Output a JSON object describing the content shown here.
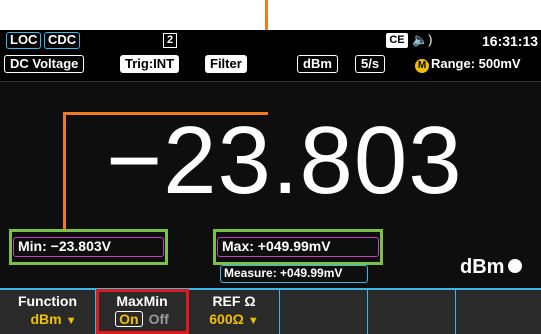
{
  "status_bar": {
    "remote_label": "LOC",
    "interface_label": "CDC",
    "page_indicator": "2",
    "ce_icon": "CE",
    "speaker_icon": "speaker-icon",
    "time": "16:31:13"
  },
  "mode_bar": {
    "function": "DC Voltage",
    "trigger": "Trig:INT",
    "filter": "Filter",
    "unit_mode": "dBm",
    "rate": "5/s",
    "manual_badge": "M",
    "range": "Range: 500mV"
  },
  "measurement": {
    "main_value": "−23.803",
    "min_label": "Min: −23.803V",
    "max_label": "Max: +049.99mV",
    "measure_label": "Measure: +049.99mV",
    "unit": "dBm"
  },
  "softkeys": [
    {
      "title": "Function",
      "value": "dBm"
    },
    {
      "title": "MaxMin",
      "on": "On",
      "off": "Off"
    },
    {
      "title": "REF Ω",
      "value": "600Ω"
    },
    {
      "title": "",
      "value": ""
    },
    {
      "title": "",
      "value": ""
    }
  ],
  "colors": {
    "accent_cyan": "#39b8e8",
    "softkey_yellow": "#f0c000",
    "highlight_green": "#7cc04a",
    "highlight_red": "#e01a1a",
    "callout_orange": "#f07b1e",
    "border_magenta": "#c040c0"
  }
}
